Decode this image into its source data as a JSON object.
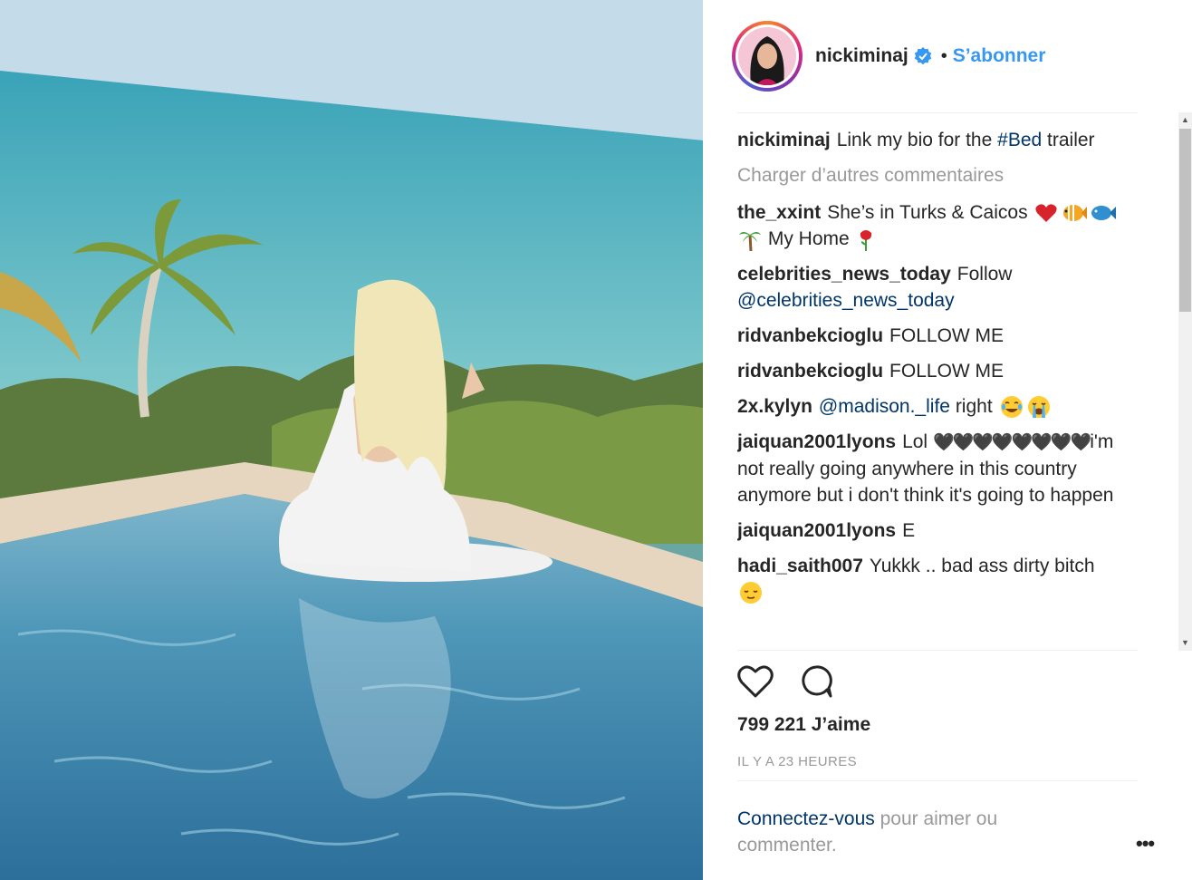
{
  "post": {
    "username": "nickiminaj",
    "follow_label": "S’abonner",
    "separator": "•",
    "caption": {
      "username": "nickiminaj",
      "text_before": "Link my bio for the",
      "hashtag": "#Bed",
      "text_after": "trailer"
    },
    "load_more": "Charger d’autres commentaires",
    "comments": [
      {
        "user": "the_xxint",
        "text": "She’s in Turks & Caicos",
        "emojis_1": [
          "heart",
          "tropical-fish",
          "fish"
        ],
        "line2_text": "My Home",
        "emojis_2_before": [
          "palm-tree"
        ],
        "emojis_2_after": [
          "rose"
        ]
      },
      {
        "user": "celebrities_news_today",
        "text": "Follow",
        "mention": "@celebrities_news_today"
      },
      {
        "user": "ridvanbekcioglu",
        "text": "FOLLOW ME"
      },
      {
        "user": "ridvanbekcioglu",
        "text": "FOLLOW ME"
      },
      {
        "user": "2x.kylyn",
        "mention": "@madison._life",
        "text": "right",
        "emojis": [
          "joy-face",
          "crying-face"
        ]
      },
      {
        "user": "jaiquan2001lyons",
        "text_before": "Lol",
        "hearts": "🖤🖤🖤🖤🖤🖤🖤🖤",
        "text": "i'm not really going anywhere in this country anymore but i don't think it's going to happen"
      },
      {
        "user": "jaiquan2001lyons",
        "text": "E"
      },
      {
        "user": "hadi_saith007",
        "text": "Yukkk .. bad ass dirty bitch",
        "emojis": [
          "relieved-face"
        ]
      }
    ],
    "likes": "799 221 J’aime",
    "time": "IL Y A 23 HEURES",
    "login_link": "Connectez-vous",
    "login_text": "pour aimer ou commenter.",
    "more_label": "•••",
    "colors": {
      "link": "#003569",
      "follow": "#3897f0",
      "muted": "#999999"
    }
  }
}
